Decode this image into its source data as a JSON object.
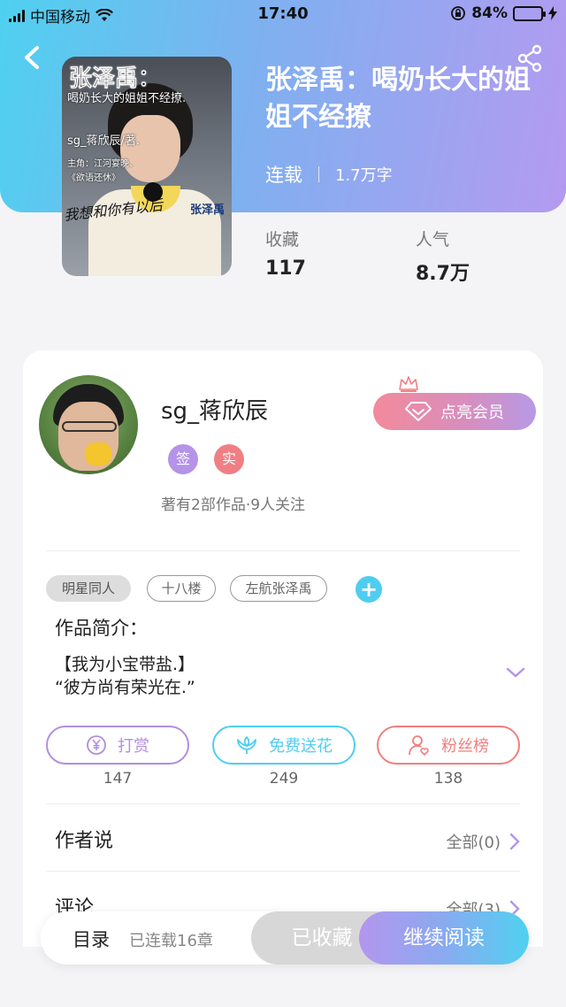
{
  "status_bar": {
    "carrier": "中国移动",
    "time": "17:40",
    "battery_pct": "84%",
    "battery_level": 0.84
  },
  "book": {
    "title": "张泽禹：喝奶长大的姐姐不经撩",
    "status": "连载",
    "word_count": "1.7万字",
    "stats": [
      {
        "label": "收藏",
        "value": "117"
      },
      {
        "label": "人气",
        "value": "8.7万"
      }
    ],
    "cover": {
      "title": "张泽禹：",
      "line1": "喝奶长大的姐姐不经撩.",
      "line2": "sg_蒋欣辰/著.",
      "line3": "主角：江河宴晚、",
      "line4": "《欲语还休》",
      "name_tag": "张泽禹",
      "signature": "我想和你有以后"
    }
  },
  "author": {
    "name": "sg_蒋欣辰",
    "badges": [
      "签",
      "实"
    ],
    "summary": "著有2部作品·9人关注",
    "vip_label": "点亮会员"
  },
  "tags": [
    "明星同人",
    "十八楼",
    "左航张泽禹"
  ],
  "intro": {
    "heading": "作品简介：",
    "lines": [
      "【我为小宝带盐.】",
      "“彼方尚有荣光在.”"
    ]
  },
  "actions": [
    {
      "label": "打赏",
      "count": "147",
      "color": "#b08ee0",
      "icon": "yen-icon"
    },
    {
      "label": "免费送花",
      "count": "249",
      "color": "#4fcdf0",
      "icon": "flower-icon"
    },
    {
      "label": "粉丝榜",
      "count": "138",
      "color": "#f07f7f",
      "icon": "fan-icon"
    }
  ],
  "sections": [
    {
      "title": "作者说",
      "link": "全部(0)"
    },
    {
      "title": "评论",
      "link": "全部(3)"
    }
  ],
  "bottom_bar": {
    "toc": "目录",
    "chapters": "已连载16章",
    "collected": "已收藏",
    "continue": "继续阅读"
  },
  "colors": {
    "accent_cyan": "#4fd1f0",
    "accent_purple": "#b49af0",
    "badge_sign": "#b493e8",
    "badge_real": "#f07f85"
  }
}
